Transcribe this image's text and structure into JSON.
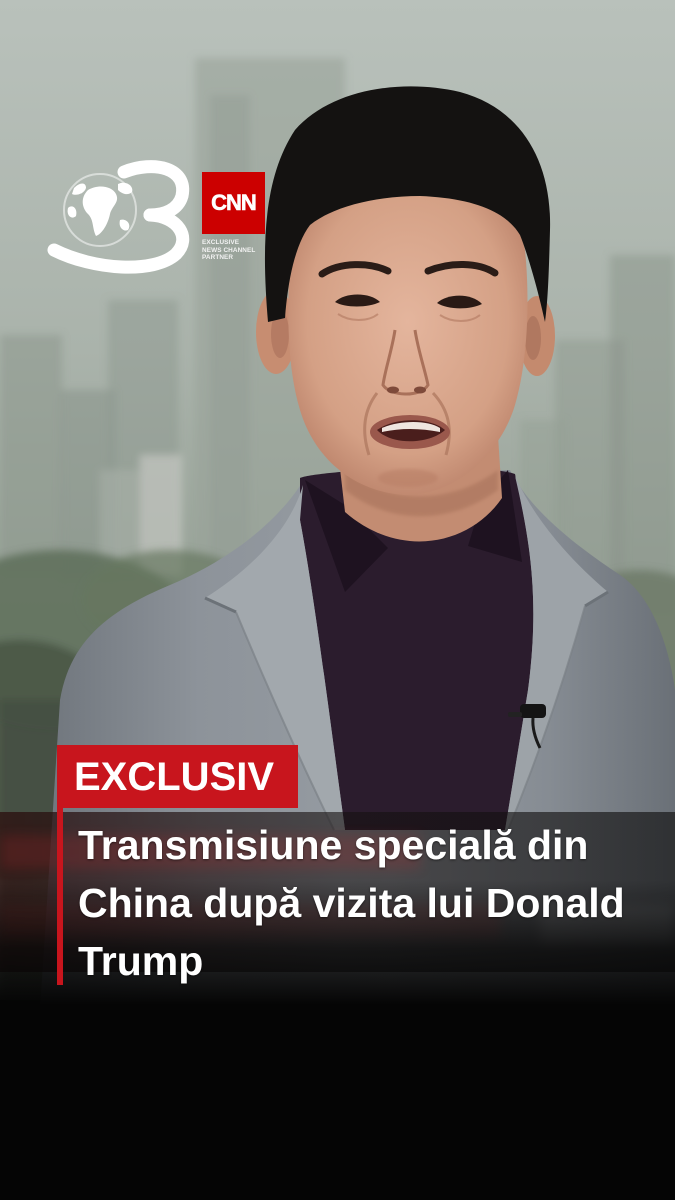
{
  "channel_logo": {
    "icon": "antena-3-globe-logo",
    "color": "#ffffff"
  },
  "partner_logo": {
    "wordmark": "CNN",
    "caption_lines": [
      "EXCLUSIVE",
      "NEWS CHANNEL",
      "PARTNER"
    ],
    "brand_color": "#cc0000"
  },
  "lower_third": {
    "badge": "EXCLUSIV",
    "headline_lines": [
      "Transmisiune specială din",
      "China după vizita lui Donald",
      "Trump"
    ],
    "accent_color": "#c8151d",
    "text_color": "#ffffff"
  }
}
